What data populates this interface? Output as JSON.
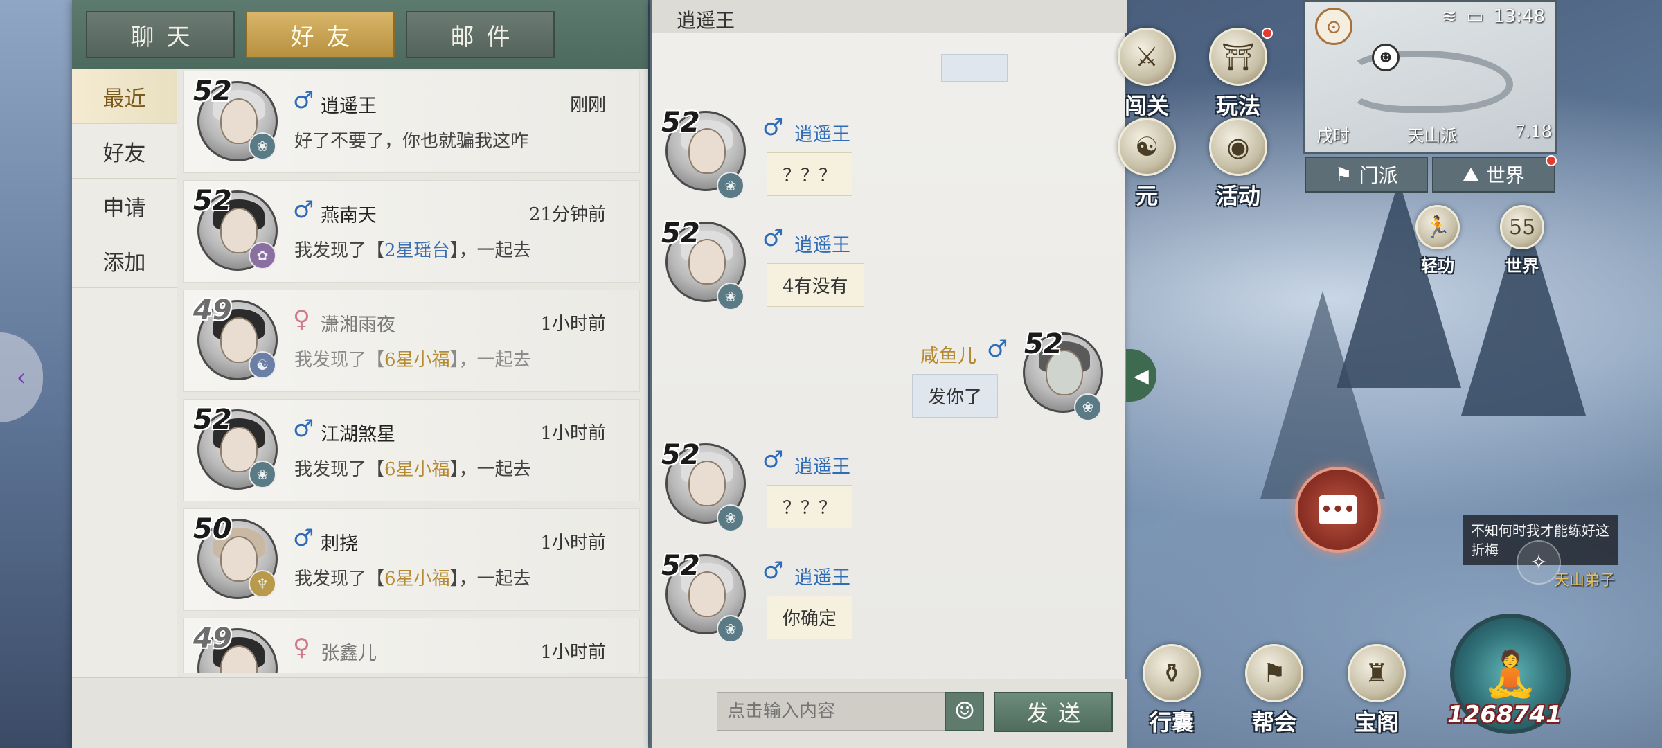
{
  "tabs": [
    {
      "label": "聊天",
      "active": false
    },
    {
      "label": "好友",
      "active": true
    },
    {
      "label": "邮件",
      "active": false
    }
  ],
  "side_nav": [
    {
      "label": "最近",
      "active": true
    },
    {
      "label": "好友",
      "active": false
    },
    {
      "label": "申请",
      "active": false
    },
    {
      "label": "添加",
      "active": false
    }
  ],
  "friends": [
    {
      "level": "52",
      "gender": "♂",
      "name": "逍遥王",
      "time": "刚刚",
      "msg_pre": "好了不要了，你也就骗我这咋",
      "msg_hl": "",
      "msg_post": ""
    },
    {
      "level": "52",
      "gender": "♂",
      "name": "燕南天",
      "time": "21分钟前",
      "msg_pre": "我发现了【",
      "msg_hl": "2星瑶台",
      "msg_post": "】，一起去"
    },
    {
      "level": "49",
      "gender": "♀",
      "name": "潇湘雨夜",
      "time": "1小时前",
      "msg_pre": "我发现了【",
      "msg_hl": "6星小福",
      "msg_post": "】，一起去"
    },
    {
      "level": "52",
      "gender": "♂",
      "name": "江湖煞星",
      "time": "1小时前",
      "msg_pre": "我发现了【",
      "msg_hl": "6星小福",
      "msg_post": "】，一起去"
    },
    {
      "level": "50",
      "gender": "♂",
      "name": "刺挠",
      "time": "1小时前",
      "msg_pre": "我发现了【",
      "msg_hl": "6星小福",
      "msg_post": "】，一起去"
    },
    {
      "level": "49",
      "gender": "♀",
      "name": "张鑫儿",
      "time": "1小时前",
      "msg_pre": "",
      "msg_hl": "",
      "msg_post": ""
    }
  ],
  "chat": {
    "title": "逍遥王",
    "messages": [
      {
        "sender": "逍遥王",
        "level": "52",
        "gender": "♂",
        "text": "？？？",
        "me": false
      },
      {
        "sender": "逍遥王",
        "level": "52",
        "gender": "♂",
        "text": "4有没有",
        "me": false
      },
      {
        "sender": "咸鱼儿",
        "level": "52",
        "gender": "♂",
        "text": "发你了",
        "me": true
      },
      {
        "sender": "逍遥王",
        "level": "52",
        "gender": "♂",
        "text": "？？？",
        "me": false
      },
      {
        "sender": "逍遥王",
        "level": "52",
        "gender": "♂",
        "text": "你确定",
        "me": false
      }
    ],
    "input_placeholder": "点击输入内容",
    "send_label": "发送",
    "emoji_glyph": "☺"
  },
  "hud": {
    "status": {
      "time": "13:48",
      "wifi": "wifi-icon",
      "battery": "battery-icon"
    },
    "minimap": {
      "shichen": "戌时",
      "sect": "天山派",
      "coord": "7.18"
    },
    "map_tabs": [
      {
        "label": "门派",
        "icon": "sect-flag-icon"
      },
      {
        "label": "世界",
        "icon": "world-icon",
        "badge": true
      }
    ],
    "buttons": [
      {
        "label": "闯关",
        "icon": "challenge-icon"
      },
      {
        "label": "玩法",
        "icon": "gameplay-icon",
        "badge": true
      },
      {
        "label": "元",
        "icon": "yuan-icon"
      },
      {
        "label": "活动",
        "icon": "activity-icon"
      },
      {
        "label": "轻功",
        "icon": "qinggong-icon"
      },
      {
        "label": "世界",
        "icon": "world-level-icon",
        "value": "55"
      },
      {
        "label": "行囊",
        "icon": "bag-icon"
      },
      {
        "label": "帮会",
        "icon": "guild-icon"
      },
      {
        "label": "宝阁",
        "icon": "treasure-icon"
      }
    ],
    "npc": {
      "speech": "不知何时我才能练好这折梅",
      "name": "天山弟子"
    },
    "power": "1268741"
  },
  "colors": {
    "active_tab": "#c9a656",
    "male": "#2f6cb8",
    "female": "#d07a8e",
    "send_button": "#5d7c6b"
  }
}
